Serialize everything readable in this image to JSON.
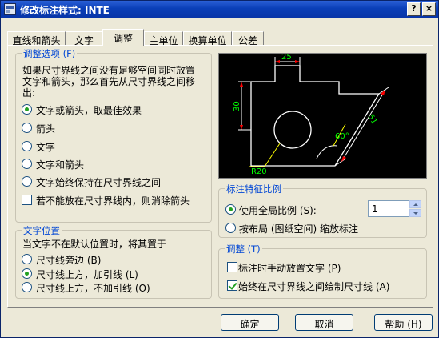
{
  "window": {
    "title": "修改标注样式: INTE",
    "help_button": "?",
    "close_button": "×"
  },
  "tabs": [
    "直线和箭头",
    "文字",
    "调整",
    "主单位",
    "换算单位",
    "公差"
  ],
  "fit_options": {
    "title": "调整选项 (F)",
    "description_line1": "如果尺寸界线之间没有足够空间同时放置",
    "description_line2": "文字和箭头，那么首先从尺寸界线之间移",
    "description_line3": "出:",
    "radios": [
      {
        "label": "文字或箭头，取最佳效果",
        "selected": true
      },
      {
        "label": "箭头",
        "selected": false
      },
      {
        "label": "文字",
        "selected": false
      },
      {
        "label": "文字和箭头",
        "selected": false
      },
      {
        "label": "文字始终保持在尺寸界线之间",
        "selected": false
      }
    ],
    "checkbox": {
      "label": "若不能放在尺寸界线内，则消除箭头",
      "checked": false
    }
  },
  "text_placement": {
    "title": "文字位置",
    "description": "当文字不在默认位置时，将其置于",
    "radios": [
      {
        "label": "尺寸线旁边 (B)",
        "selected": false
      },
      {
        "label": "尺寸线上方，加引线 (L)",
        "selected": true
      },
      {
        "label": "尺寸线上方，不加引线 (O)",
        "selected": false
      }
    ]
  },
  "preview": {
    "labels": [
      "25",
      "30",
      "51",
      "60°",
      "R20"
    ]
  },
  "scale": {
    "title": "标注特征比例",
    "radios": [
      {
        "label": "使用全局比例 (S):",
        "selected": true
      },
      {
        "label": "按布局 (图纸空间) 缩放标注",
        "selected": false
      }
    ],
    "value": "1"
  },
  "fine_tuning": {
    "title": "调整 (T)",
    "checkboxes": [
      {
        "label": "标注时手动放置文字 (P)",
        "checked": false
      },
      {
        "label": "始终在尺寸界线之间绘制尺寸线 (A)",
        "checked": true
      }
    ]
  },
  "buttons": {
    "ok": "确定",
    "cancel": "取消",
    "help": "帮助 (H)"
  },
  "colors": {
    "titlebar": "#0a3fb8",
    "group_title": "#0046d5",
    "preview_bg": "#000000",
    "preview_geometry": "#ffffff",
    "preview_dimensions": "#00ff00",
    "preview_leaders": "#ffff00",
    "preview_arrows": "#ff0000"
  }
}
